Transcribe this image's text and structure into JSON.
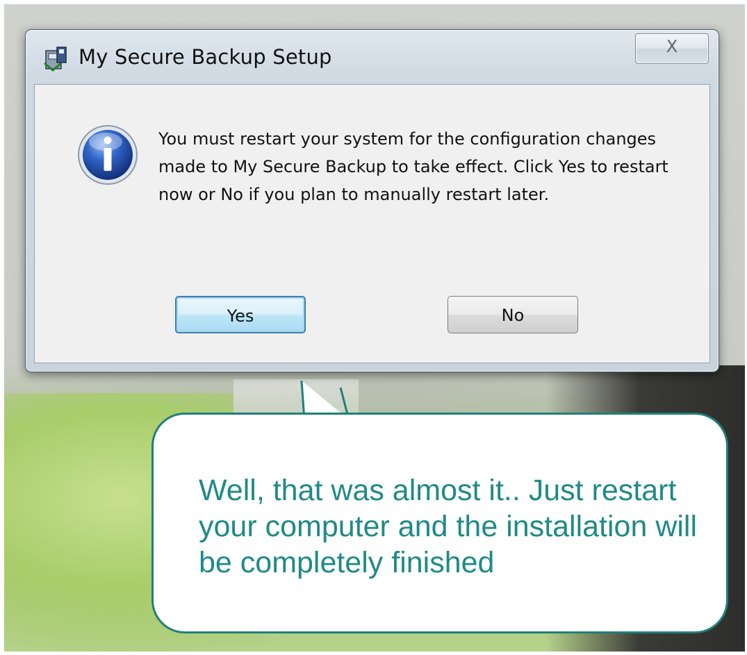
{
  "window": {
    "title": "My Secure Backup Setup",
    "close_glyph": "X",
    "app_icon": "setup-package-icon"
  },
  "dialog": {
    "icon": "information-icon",
    "message": "You must restart your system for the configuration changes made to My Secure Backup to take effect. Click Yes to restart now or No if you plan to manually restart later.",
    "yes_label": "Yes",
    "no_label": "No"
  },
  "callout": {
    "text": "Well, that was almost it.. Just restart your computer and the installation will be completely finished"
  },
  "colors": {
    "callout_text": "#1f8a86",
    "callout_border": "#1f7f7a",
    "default_button_border": "#3c7fb1"
  }
}
